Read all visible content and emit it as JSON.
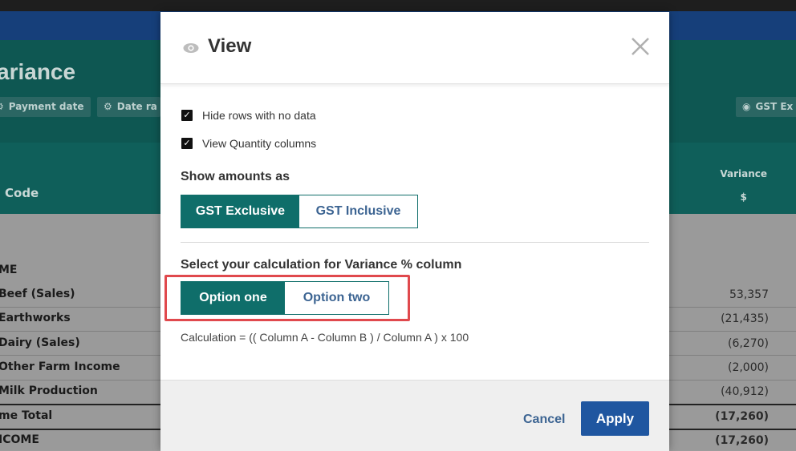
{
  "background": {
    "page_title": "ariance",
    "filters": [
      {
        "icon": "gear-icon",
        "label": "Payment date"
      },
      {
        "icon": "gear-icon",
        "label": "Date ra"
      },
      {
        "icon": "eye-icon",
        "label": "GST Ex"
      }
    ],
    "columns": {
      "code": "Code",
      "variance": "Variance",
      "variance_unit": "$"
    },
    "rows": [
      {
        "label": "ME",
        "value": ""
      },
      {
        "label": "Beef (Sales)",
        "value": "53,357"
      },
      {
        "label": "Earthworks",
        "value": "(21,435)"
      },
      {
        "label": "Dairy (Sales)",
        "value": "(6,270)"
      },
      {
        "label": "Other Farm Income",
        "value": "(2,000)"
      },
      {
        "label": "Milk Production",
        "value": "(40,912)"
      },
      {
        "label": "me Total",
        "value": "(17,260)"
      },
      {
        "label": "ICOME",
        "value": "(17,260)"
      }
    ]
  },
  "modal": {
    "title": "View",
    "title_icon": "eye-icon",
    "checkboxes": [
      {
        "label": "Hide rows with no data",
        "checked": true
      },
      {
        "label": "View Quantity columns",
        "checked": true
      }
    ],
    "amounts_label": "Show amounts as",
    "amounts_options": [
      "GST Exclusive",
      "GST Inclusive"
    ],
    "amounts_selected": "GST Exclusive",
    "variance_label": "Select your calculation for Variance % column",
    "variance_options": [
      "Option one",
      "Option two"
    ],
    "variance_selected": "Option one",
    "calculation_text": "Calculation = (( Column A - Column B ) / Column A ) x 100",
    "cancel_label": "Cancel",
    "apply_label": "Apply"
  },
  "colors": {
    "accent": "#0f6e6a",
    "primary": "#1f56a0",
    "link": "#3c6492",
    "highlight": "#e0494d"
  }
}
